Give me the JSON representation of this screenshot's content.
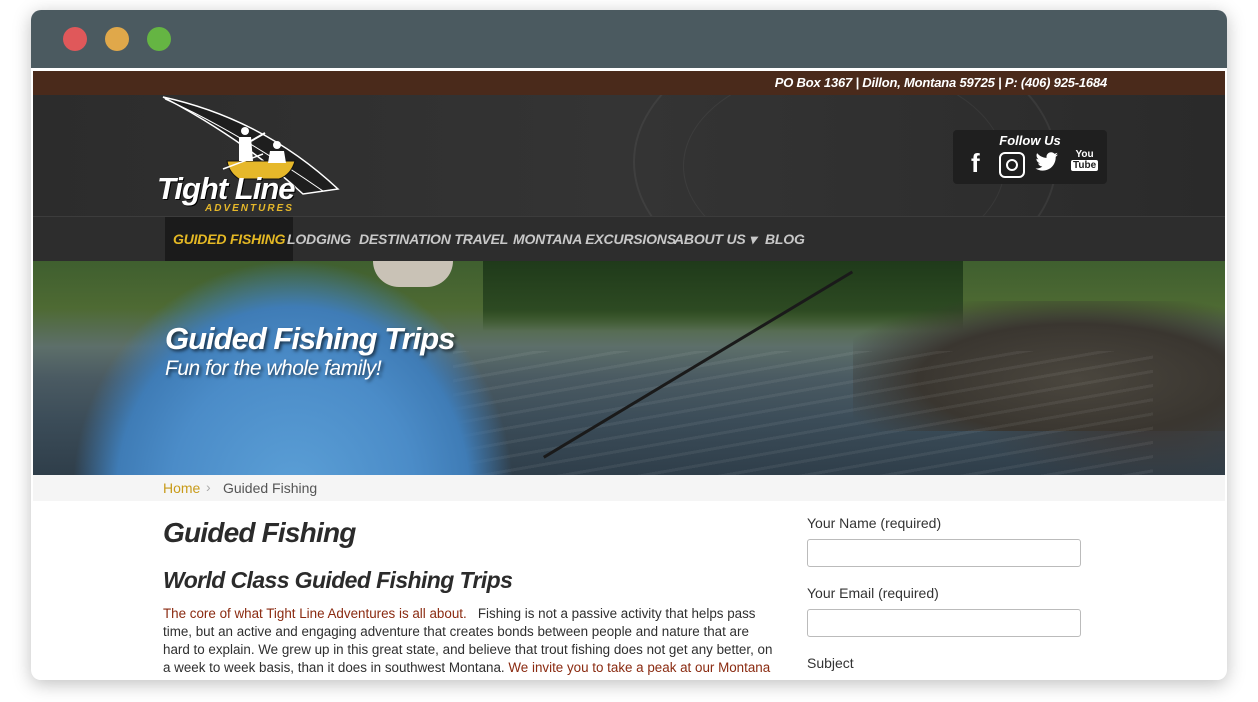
{
  "topbar": {
    "address": "PO Box 1367 | Dillon, Montana 59725 | P: (406) 925-1684"
  },
  "logo": {
    "title": "Tight Line",
    "subtitle": "ADVENTURES"
  },
  "social": {
    "title": "Follow Us",
    "icons": [
      "facebook-icon",
      "instagram-icon",
      "twitter-icon",
      "youtube-icon"
    ],
    "youtube_top": "You",
    "youtube_bottom": "Tube"
  },
  "nav": {
    "items": [
      {
        "label": "GUIDED FISHING"
      },
      {
        "label": "LODGING"
      },
      {
        "label": "DESTINATION TRAVEL"
      },
      {
        "label": "MONTANA EXCURSIONS"
      },
      {
        "label": "ABOUT US ▾"
      },
      {
        "label": "BLOG"
      }
    ],
    "active_color": "#e4b824"
  },
  "hero": {
    "title": "Guided Fishing Trips",
    "subtitle": "Fun for the whole family!"
  },
  "breadcrumb": {
    "home": "Home",
    "separator": "›",
    "current": "Guided Fishing"
  },
  "main": {
    "title": "Guided Fishing",
    "section_title": "World Class Guided Fishing Trips",
    "para_lead": "The core of what Tight Line Adventures is all about.",
    "para_body": "Fishing is not a passive activity that helps pass time, but an active and engaging adventure that creates bonds between people and nature that are hard to explain. We grew up in this great state, and believe that trout fishing does not get any better, on a week to week basis, than it does in southwest Montana.",
    "para_link": "We invite you to take a peak at our Montana Guided"
  },
  "form": {
    "name_label": "Your Name (required)",
    "name_value": "",
    "email_label": "Your Email (required)",
    "email_value": "",
    "subject_label": "Subject"
  },
  "colors": {
    "topbar": "#4a2a1b",
    "header": "#2c2c2c",
    "accent": "#e4b824",
    "link": "#8a2a10"
  }
}
